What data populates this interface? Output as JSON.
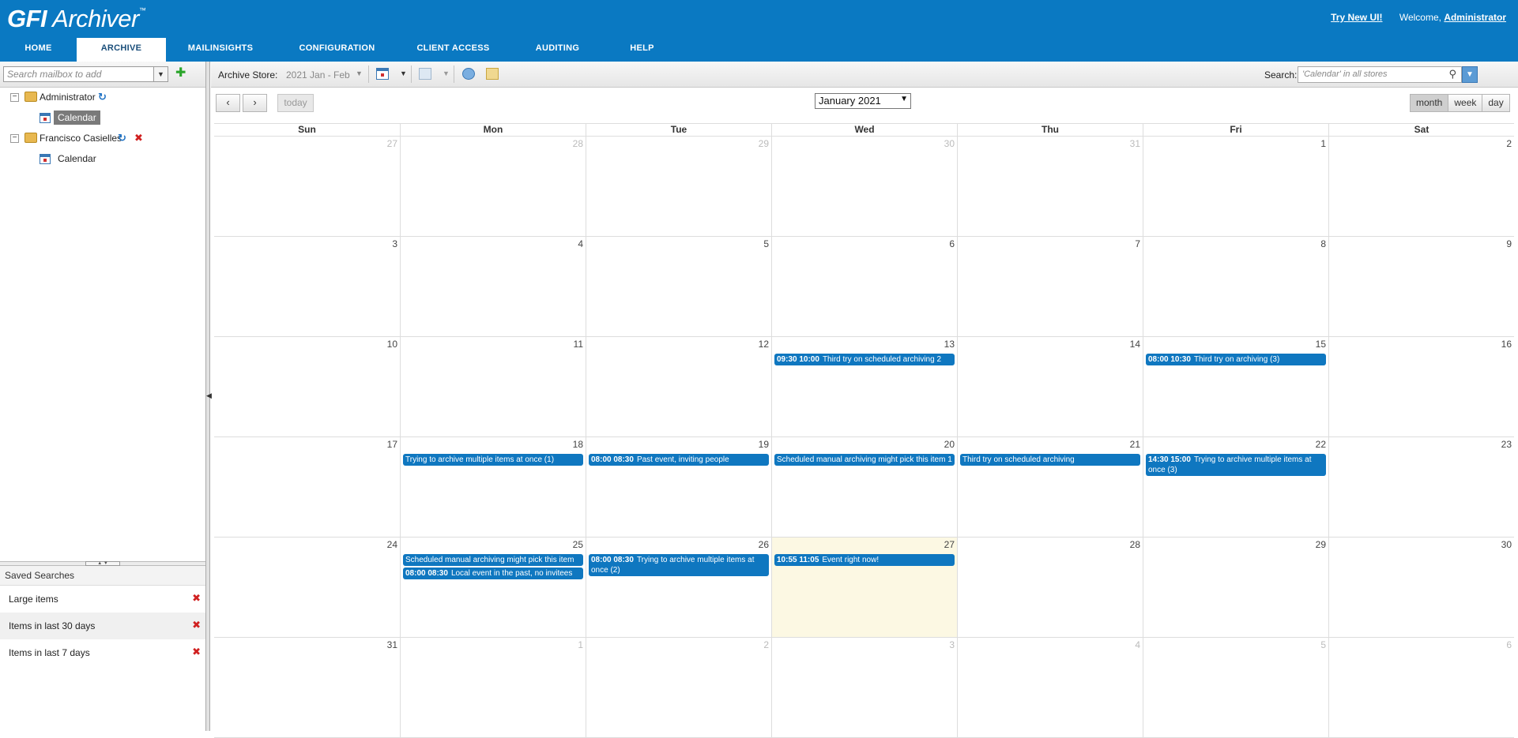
{
  "app": {
    "brand": "GFI",
    "name": "Archiver",
    "tm": "™",
    "try_new": "Try New UI!",
    "welcome": "Welcome,",
    "user": "Administrator"
  },
  "nav": [
    "Home",
    "Archive",
    "MailInsights",
    "Configuration",
    "Client Access",
    "Auditing",
    "Help"
  ],
  "left": {
    "search_placeholder": "Search mailbox to add",
    "tree": [
      {
        "label": "Administrator",
        "child": "Calendar"
      },
      {
        "label": "Francisco Casielles",
        "child": "Calendar"
      }
    ],
    "saved_title": "Saved Searches",
    "saved": [
      "Large items",
      "Items in last 30 days",
      "Items in last 7 days"
    ]
  },
  "toolbar": {
    "store_label": "Archive Store:",
    "store_value": "2021 Jan - Feb",
    "search_label": "Search:",
    "search_placeholder": "'Calendar' in all stores"
  },
  "calendar": {
    "today_label": "today",
    "month": "January 2021",
    "views": [
      "month",
      "week",
      "day"
    ],
    "days": [
      "Sun",
      "Mon",
      "Tue",
      "Wed",
      "Thu",
      "Fri",
      "Sat"
    ],
    "weeks": [
      [
        {
          "n": "27",
          "o": true
        },
        {
          "n": "28",
          "o": true
        },
        {
          "n": "29",
          "o": true
        },
        {
          "n": "30",
          "o": true
        },
        {
          "n": "31",
          "o": true
        },
        {
          "n": "1"
        },
        {
          "n": "2"
        }
      ],
      [
        {
          "n": "3"
        },
        {
          "n": "4"
        },
        {
          "n": "5"
        },
        {
          "n": "6"
        },
        {
          "n": "7"
        },
        {
          "n": "8"
        },
        {
          "n": "9"
        }
      ],
      [
        {
          "n": "10"
        },
        {
          "n": "11"
        },
        {
          "n": "12"
        },
        {
          "n": "13",
          "events": [
            {
              "time": "09:30 10:00",
              "title": "Third try on scheduled archiving 2"
            }
          ]
        },
        {
          "n": "14"
        },
        {
          "n": "15",
          "events": [
            {
              "time": "08:00 10:30",
              "title": "Third try on archiving (3)"
            }
          ]
        },
        {
          "n": "16"
        }
      ],
      [
        {
          "n": "17"
        },
        {
          "n": "18",
          "events": [
            {
              "time": "",
              "title": "Trying to archive multiple items at once (1)"
            }
          ]
        },
        {
          "n": "19",
          "events": [
            {
              "time": "08:00 08:30",
              "title": "Past event, inviting people"
            }
          ]
        },
        {
          "n": "20",
          "events": [
            {
              "time": "",
              "title": "Scheduled manual archiving might pick this item 1",
              "lines": 2
            }
          ]
        },
        {
          "n": "21",
          "events": [
            {
              "time": "",
              "title": "Third try on scheduled archiving"
            }
          ]
        },
        {
          "n": "22",
          "events": [
            {
              "time": "14:30 15:00",
              "title": "Trying to archive multiple items at once (3)",
              "lines": 2
            }
          ]
        },
        {
          "n": "23"
        }
      ],
      [
        {
          "n": "24"
        },
        {
          "n": "25",
          "events": [
            {
              "time": "",
              "title": "Scheduled manual archiving might pick this item"
            },
            {
              "time": "08:00 08:30",
              "title": "Local event in the past, no invitees"
            }
          ]
        },
        {
          "n": "26",
          "events": [
            {
              "time": "08:00 08:30",
              "title": "Trying to archive multiple items at once (2)",
              "lines": 2
            }
          ]
        },
        {
          "n": "27",
          "today": true,
          "events": [
            {
              "time": "10:55 11:05",
              "title": "Event right now!"
            }
          ]
        },
        {
          "n": "28"
        },
        {
          "n": "29"
        },
        {
          "n": "30"
        }
      ],
      [
        {
          "n": "31"
        },
        {
          "n": "1",
          "o": true
        },
        {
          "n": "2",
          "o": true
        },
        {
          "n": "3",
          "o": true
        },
        {
          "n": "4",
          "o": true
        },
        {
          "n": "5",
          "o": true
        },
        {
          "n": "6",
          "o": true
        }
      ]
    ]
  }
}
